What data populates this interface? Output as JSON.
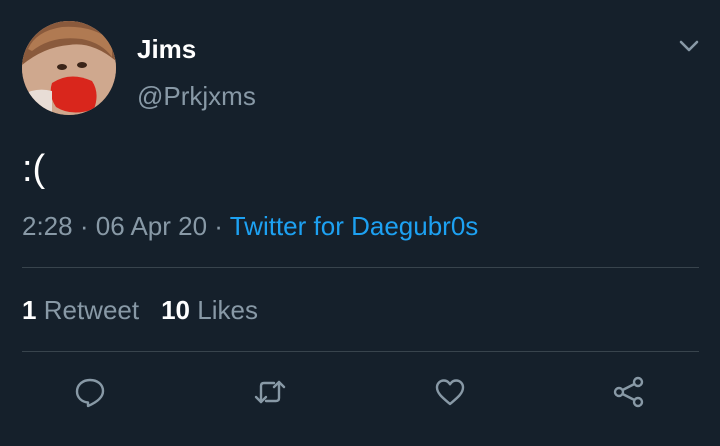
{
  "tweet": {
    "author": {
      "display_name": "Jims",
      "handle": "@Prkjxms"
    },
    "text": ":(",
    "meta": {
      "time": "2:28",
      "separator": "·",
      "date": "06 Apr 20",
      "source": "Twitter for Daegubr0s"
    },
    "stats": {
      "retweets_count": "1",
      "retweets_label": "Retweet",
      "likes_count": "10",
      "likes_label": "Likes"
    },
    "actions": {
      "reply_icon": "speech-bubble",
      "retweet_icon": "retweet-arrows",
      "like_icon": "heart",
      "share_icon": "share-nodes"
    }
  },
  "colors": {
    "background": "#15202b",
    "primary_text": "#ffffff",
    "secondary_text": "#8899a6",
    "link": "#1da1f2",
    "divider": "#38444d"
  }
}
